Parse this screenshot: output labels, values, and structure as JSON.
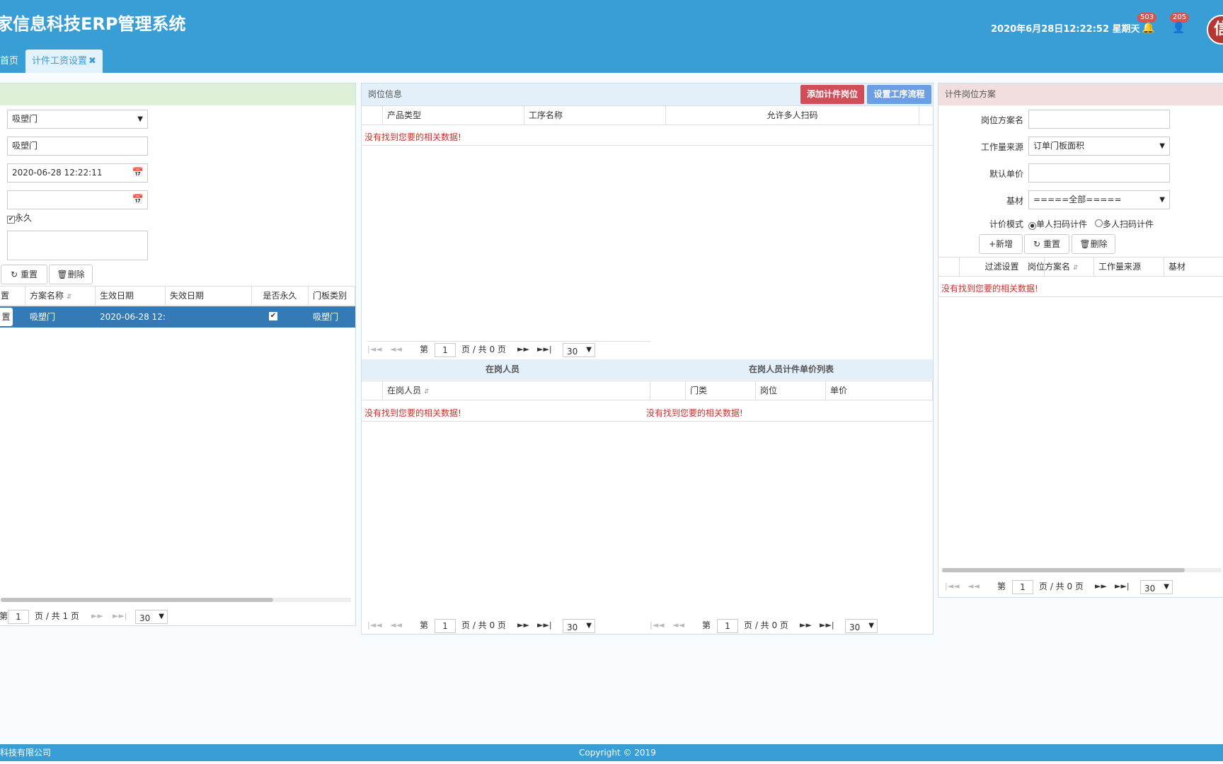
{
  "header": {
    "app_title": "家信息科技ERP管理系统",
    "datetime": "2020年6月28日12:22:52 星期天",
    "notifications_badge": "503",
    "users_badge": "205",
    "avatar_text": "信"
  },
  "tabs": [
    {
      "label": "首页"
    },
    {
      "label": "计件工资设置",
      "close": "✖"
    }
  ],
  "left_panel": {
    "door_type_select": "吸塑门",
    "plan_name": "吸塑门",
    "effective_date": "2020-06-28 12:22:11",
    "expiry_date": "",
    "permanent_label": "永久",
    "buttons": {
      "reset": "重置",
      "delete": "删除"
    },
    "columns": [
      "置",
      "方案名称",
      "生效日期",
      "失效日期",
      "是否永久",
      "门板类别"
    ],
    "rows": [
      {
        "action": "置",
        "name": "吸塑门",
        "effective": "2020-06-28 12:",
        "expiry": "",
        "door_type": "吸塑门"
      }
    ],
    "pager": {
      "page": "1",
      "of": "页 / 共 1 页",
      "size": "30"
    }
  },
  "middle_panel": {
    "title": "岗位信息",
    "add_button": "添加计件岗位",
    "flow_button": "设置工序流程",
    "columns": [
      "产品类型",
      "工序名称",
      "允许多人扫码"
    ],
    "no_data": "没有找到您要的相关数据!",
    "pager": {
      "prefix": "第",
      "page": "1",
      "of": "页 / 共 0 页",
      "size": "30"
    },
    "staff_title": "在岗人员",
    "staff_column": "在岗人员",
    "price_title": "在岗人员计件单价列表",
    "price_columns": [
      "门类",
      "岗位",
      "单价"
    ]
  },
  "right_panel": {
    "title": "计件岗位方案",
    "labels": {
      "scheme_name": "岗位方案名",
      "workload_source": "工作量来源",
      "default_price": "默认单价",
      "substrate": "基材",
      "pricing_mode": "计价模式"
    },
    "workload_source_value": "订单门板面积",
    "substrate_value": "=====全部=====",
    "mode_single": "单人扫码计件",
    "mode_multi": "多人扫码计件",
    "buttons": {
      "add": "新增",
      "reset": "重置",
      "delete": "删除"
    },
    "columns": [
      "过滤设置",
      "岗位方案名",
      "工作量来源",
      "基材"
    ],
    "no_data": "没有找到您要的相关数据!",
    "pager": {
      "prefix": "第",
      "page": "1",
      "of": "页 / 共 0 页",
      "size": "30"
    }
  },
  "footer": {
    "company": "科技有限公司",
    "copyright": "Copyright © 2019"
  },
  "colors": {
    "header": "#3a9ed6",
    "danger": "#d24d57",
    "primary_btn": "#6c9ee3",
    "selected_row": "#337ab7"
  }
}
